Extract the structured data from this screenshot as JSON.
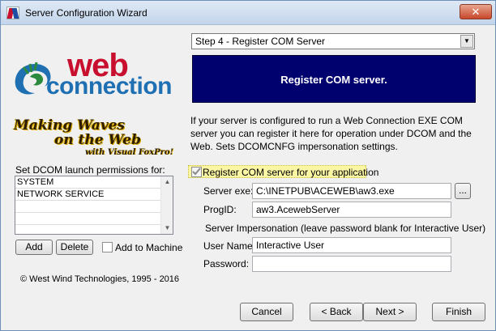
{
  "window": {
    "title": "Server Configuration Wizard",
    "close_label": "✕",
    "app_icon": "wwc-icon"
  },
  "branding": {
    "logo_web": "web",
    "logo_connection": "connection",
    "tagline_line1": "Making Waves",
    "tagline_line2": "on the Web",
    "tagline_line3": "with Visual FoxPro!"
  },
  "dcom": {
    "label": "Set DCOM launch permissions for:",
    "items": [
      "SYSTEM",
      "NETWORK SERVICE",
      "",
      "",
      ""
    ],
    "add_label": "Add",
    "delete_label": "Delete",
    "add_to_machine_label": "Add to Machine",
    "add_to_machine_checked": false
  },
  "copyright": "© West Wind Technologies, 1995 - 2016",
  "step": {
    "selected": "Step 4 - Register COM Server"
  },
  "banner": {
    "title": "Register COM server.",
    "color": "#00006e"
  },
  "description": "If your server is configured to run a Web Connection EXE COM server you can register it here for operation under DCOM and the Web. Sets DCOMCNFG impersonation settings.",
  "register": {
    "label": "Register COM server for your application",
    "checked": true,
    "highlight_color": "#fbf6a4"
  },
  "form": {
    "server_exe_label": "Server exe:",
    "server_exe_value": "C:\\INETPUB\\ACEWEB\\aw3.exe",
    "browse_label": "...",
    "progid_label": "ProgID:",
    "progid_value": "aw3.AcewebServer",
    "impersonation_label": "Server Impersonation (leave password blank for Interactive User)",
    "username_label": "User Name:",
    "username_value": "Interactive User",
    "password_label": "Password:",
    "password_value": ""
  },
  "buttons": {
    "cancel": "Cancel",
    "back": "< Back",
    "next": "Next >",
    "finish": "Finish"
  }
}
